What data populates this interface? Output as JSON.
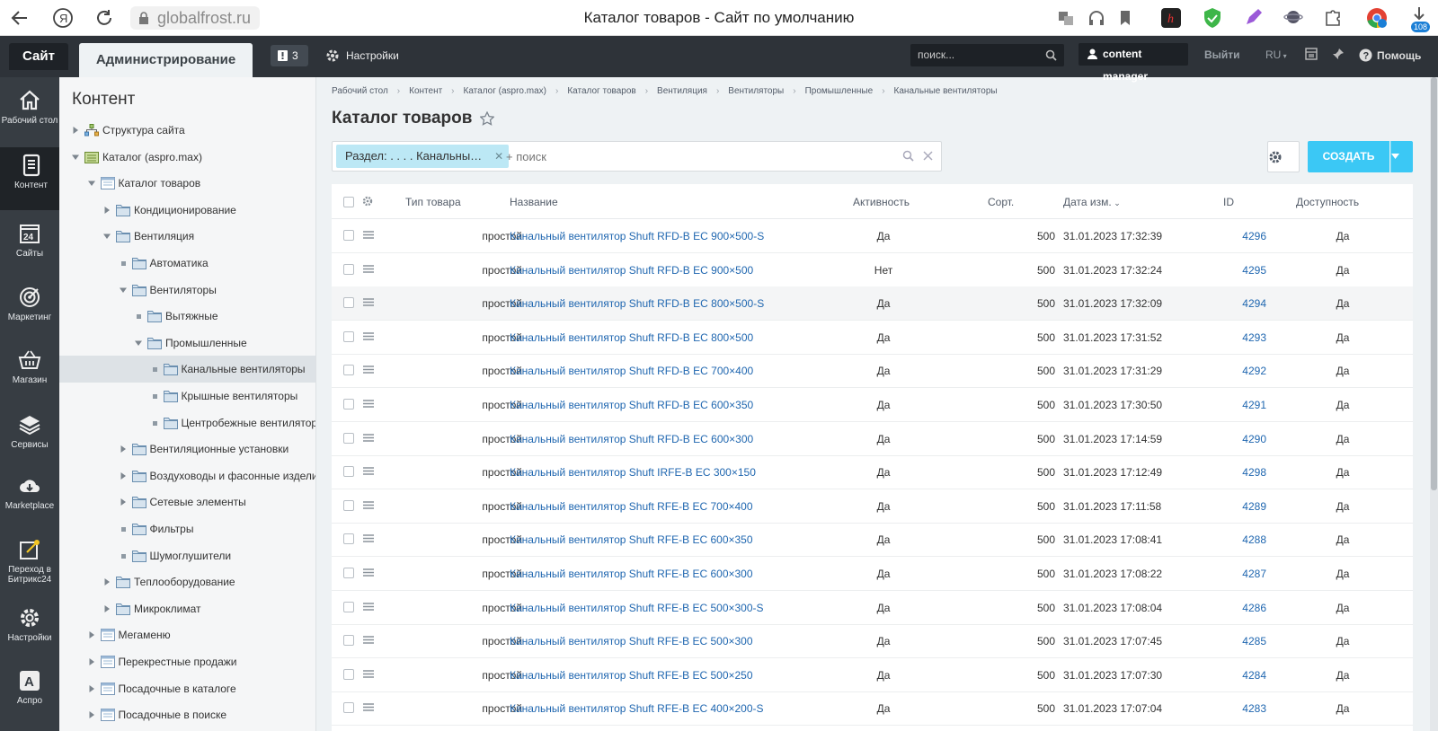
{
  "browser": {
    "url": "globalfrost.ru",
    "tab_title": "Каталог товаров - Сайт по умолчанию",
    "download_badge": "108"
  },
  "admin_bar": {
    "site": "Сайт",
    "admin": "Администрирование",
    "notifications": "3",
    "settings": "Настройки",
    "search_placeholder": "поиск...",
    "user": "content manager",
    "logout": "Выйти",
    "lang": "RU",
    "help": "Помощь"
  },
  "left_menu": [
    {
      "label": "Рабочий стол",
      "icon": "home-icon"
    },
    {
      "label": "Контент",
      "icon": "document-icon"
    },
    {
      "label": "Сайты",
      "icon": "calendar-icon"
    },
    {
      "label": "Маркетинг",
      "icon": "target-icon"
    },
    {
      "label": "Магазин",
      "icon": "basket-icon"
    },
    {
      "label": "Сервисы",
      "icon": "layers-icon"
    },
    {
      "label": "Marketplace",
      "icon": "cloud-download-icon"
    },
    {
      "label": "Переход в Битрикс24",
      "icon": "bitrix24-icon"
    },
    {
      "label": "Настройки",
      "icon": "gear-icon"
    },
    {
      "label": "Аспро",
      "icon": "aspro-icon"
    }
  ],
  "tree": {
    "title": "Контент",
    "items": [
      {
        "label": "Структура сайта"
      },
      {
        "label": "Каталог (aspro.max)"
      },
      {
        "label": "Каталог товаров"
      },
      {
        "label": "Кондиционирование"
      },
      {
        "label": "Вентиляция"
      },
      {
        "label": "Автоматика"
      },
      {
        "label": "Вентиляторы"
      },
      {
        "label": "Вытяжные"
      },
      {
        "label": "Промышленные"
      },
      {
        "label": "Канальные вентиляторы"
      },
      {
        "label": "Крышные вентиляторы"
      },
      {
        "label": "Центробежные вентиляторы"
      },
      {
        "label": "Вентиляционные установки"
      },
      {
        "label": "Воздуховоды и фасонные изделия"
      },
      {
        "label": "Сетевые элементы"
      },
      {
        "label": "Фильтры"
      },
      {
        "label": "Шумоглушители"
      },
      {
        "label": "Теплооборудование"
      },
      {
        "label": "Микроклимат"
      },
      {
        "label": "Мегаменю"
      },
      {
        "label": "Перекрестные продажи"
      },
      {
        "label": "Посадочные в каталоге"
      },
      {
        "label": "Посадочные в поиске"
      }
    ]
  },
  "breadcrumb": [
    "Рабочий стол",
    "Контент",
    "Каталог (aspro.max)",
    "Каталог товаров",
    "Вентиляция",
    "Вентиляторы",
    "Промышленные",
    "Канальные вентиляторы"
  ],
  "page_title": "Каталог товаров",
  "filter": {
    "chip": "Раздел: . . . . Канальны…",
    "placeholder": "+ поиск"
  },
  "create_label": "СОЗДАТЬ",
  "grid": {
    "headers": {
      "type": "Тип товара",
      "name": "Название",
      "active": "Активность",
      "sort": "Сорт.",
      "date": "Дата изм.",
      "id": "ID",
      "avail": "Доступность"
    },
    "rows": [
      {
        "type": "простой",
        "name": "Канальный вентилятор Shuft RFD-B EC 900×500-S",
        "active": "Да",
        "sort": "500",
        "date": "31.01.2023 17:32:39",
        "id": "4296",
        "avail": "Да"
      },
      {
        "type": "простой",
        "name": "Канальный вентилятор Shuft RFD-B EC 900×500",
        "active": "Нет",
        "sort": "500",
        "date": "31.01.2023 17:32:24",
        "id": "4295",
        "avail": "Да"
      },
      {
        "type": "простой",
        "name": "Канальный вентилятор Shuft RFD-B EC 800×500-S",
        "active": "Да",
        "sort": "500",
        "date": "31.01.2023 17:32:09",
        "id": "4294",
        "avail": "Да"
      },
      {
        "type": "простой",
        "name": "Канальный вентилятор Shuft RFD-B EC 800×500",
        "active": "Да",
        "sort": "500",
        "date": "31.01.2023 17:31:52",
        "id": "4293",
        "avail": "Да"
      },
      {
        "type": "простой",
        "name": "Канальный вентилятор Shuft RFD-B EC 700×400",
        "active": "Да",
        "sort": "500",
        "date": "31.01.2023 17:31:29",
        "id": "4292",
        "avail": "Да"
      },
      {
        "type": "простой",
        "name": "Канальный вентилятор Shuft RFD-B EC 600×350",
        "active": "Да",
        "sort": "500",
        "date": "31.01.2023 17:30:50",
        "id": "4291",
        "avail": "Да"
      },
      {
        "type": "простой",
        "name": "Канальный вентилятор Shuft RFD-B EC 600×300",
        "active": "Да",
        "sort": "500",
        "date": "31.01.2023 17:14:59",
        "id": "4290",
        "avail": "Да"
      },
      {
        "type": "простой",
        "name": "Канальный вентилятор Shuft IRFE-B EC 300×150",
        "active": "Да",
        "sort": "500",
        "date": "31.01.2023 17:12:49",
        "id": "4298",
        "avail": "Да"
      },
      {
        "type": "простой",
        "name": "Канальный вентилятор Shuft RFE-B EC 700×400",
        "active": "Да",
        "sort": "500",
        "date": "31.01.2023 17:11:58",
        "id": "4289",
        "avail": "Да"
      },
      {
        "type": "простой",
        "name": "Канальный вентилятор Shuft RFE-B EC 600×350",
        "active": "Да",
        "sort": "500",
        "date": "31.01.2023 17:08:41",
        "id": "4288",
        "avail": "Да"
      },
      {
        "type": "простой",
        "name": "Канальный вентилятор Shuft RFE-B EC 600×300",
        "active": "Да",
        "sort": "500",
        "date": "31.01.2023 17:08:22",
        "id": "4287",
        "avail": "Да"
      },
      {
        "type": "простой",
        "name": "Канальный вентилятор Shuft RFE-B EC 500×300-S",
        "active": "Да",
        "sort": "500",
        "date": "31.01.2023 17:08:04",
        "id": "4286",
        "avail": "Да"
      },
      {
        "type": "простой",
        "name": "Канальный вентилятор Shuft RFE-B EC 500×300",
        "active": "Да",
        "sort": "500",
        "date": "31.01.2023 17:07:45",
        "id": "4285",
        "avail": "Да"
      },
      {
        "type": "простой",
        "name": "Канальный вентилятор Shuft RFE-B EC 500×250",
        "active": "Да",
        "sort": "500",
        "date": "31.01.2023 17:07:30",
        "id": "4284",
        "avail": "Да"
      },
      {
        "type": "простой",
        "name": "Канальный вентилятор Shuft RFE-B EC 400×200-S",
        "active": "Да",
        "sort": "500",
        "date": "31.01.2023 17:07:04",
        "id": "4283",
        "avail": "Да"
      }
    ]
  },
  "colors": {
    "accent": "#3bc8f5",
    "link": "#2067b0",
    "topbar": "#2e3339",
    "leftmenu": "#373d43"
  }
}
